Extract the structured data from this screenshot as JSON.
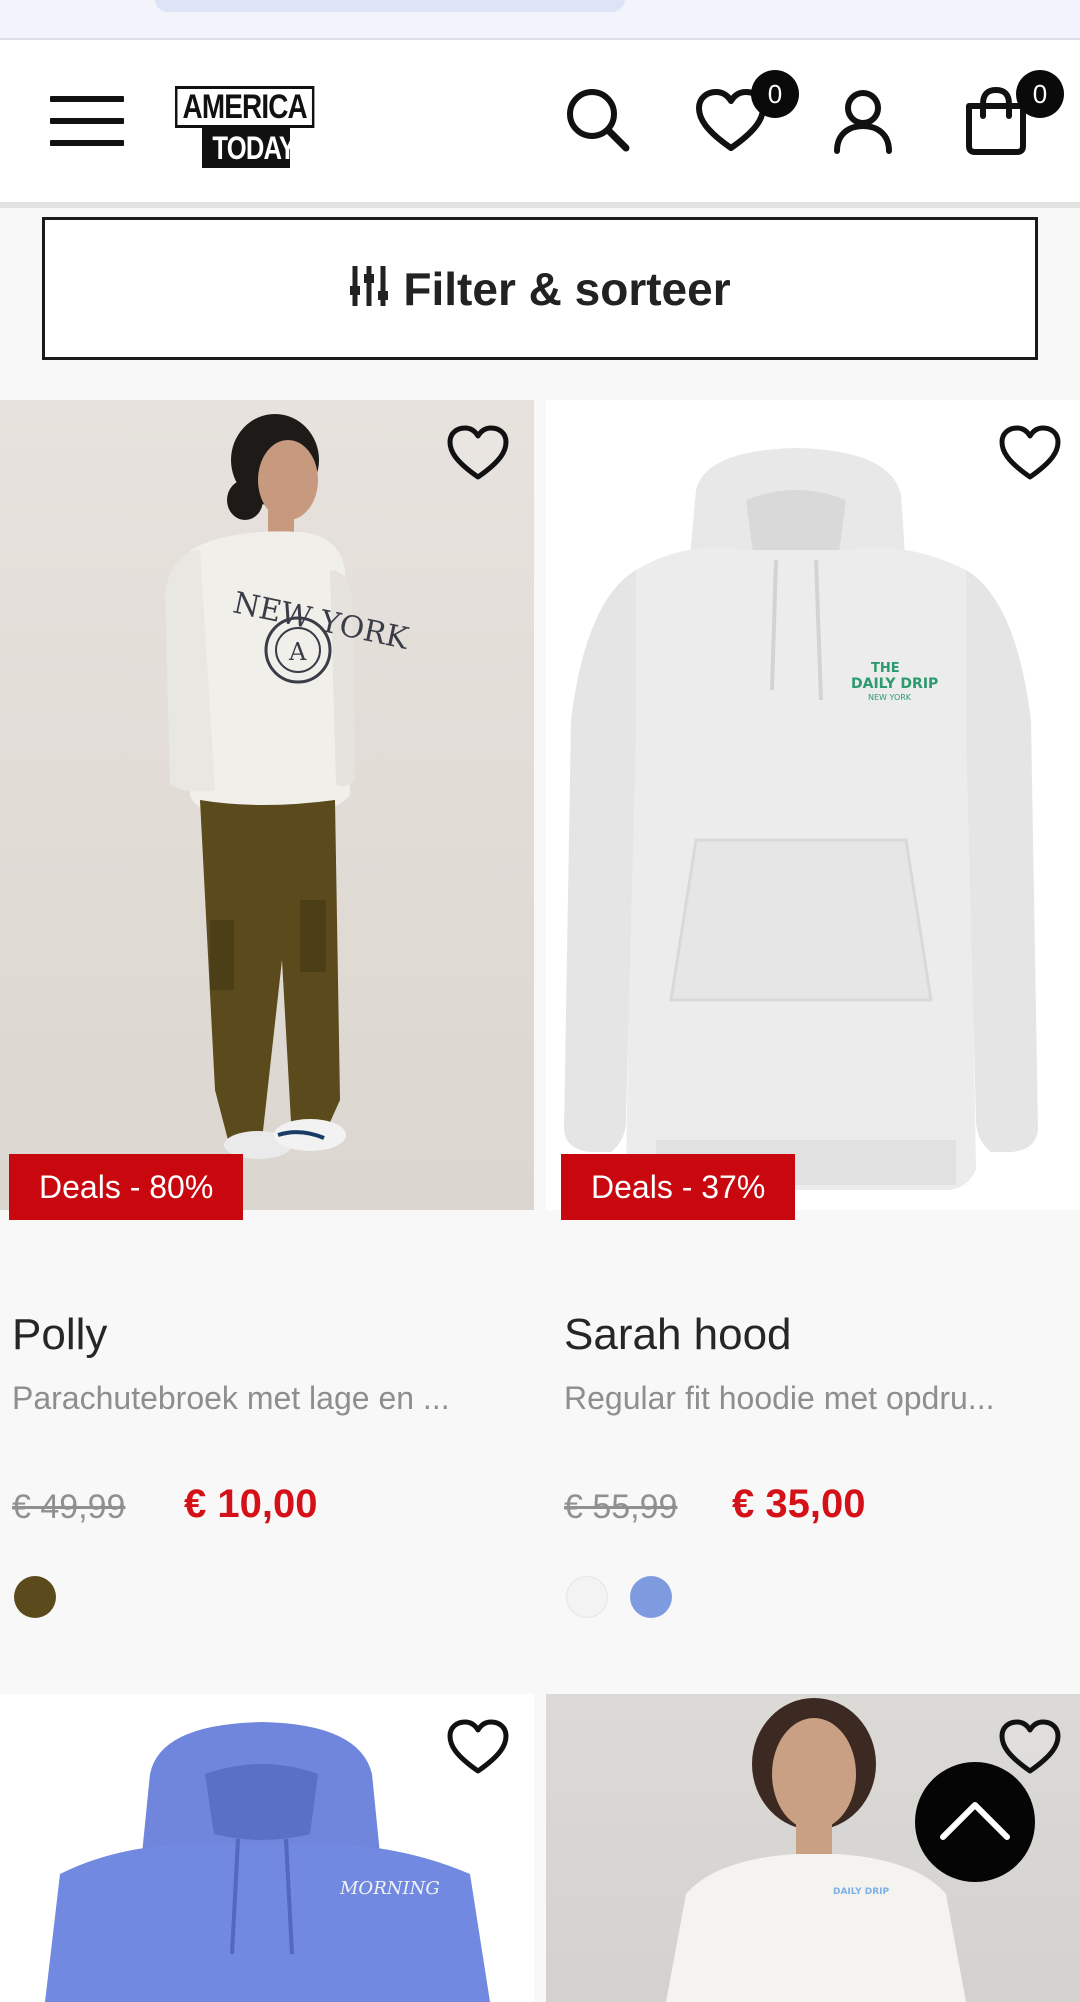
{
  "header": {
    "logo_line1": "AMERICA",
    "logo_line2": "TODAY",
    "wishlist_count": "0",
    "cart_count": "0"
  },
  "filter": {
    "label": "Filter & sorteer"
  },
  "products": [
    {
      "name": "Polly",
      "description": "Parachutebroek met lage en ...",
      "deal": "Deals - 80%",
      "old_price": "€ 49,99",
      "new_price": "€ 10,00",
      "swatches": [
        "#5a4a1c"
      ]
    },
    {
      "name": "Sarah hood",
      "description": "Regular fit hoodie met opdru...",
      "deal": "Deals - 37%",
      "old_price": "€ 55,99",
      "new_price": "€ 35,00",
      "swatches": [
        "#f3f3f3",
        "#7f9be0"
      ]
    },
    {
      "name": "",
      "description": ""
    },
    {
      "name": "",
      "description": ""
    }
  ],
  "colors": {
    "deal_red": "#c8070f",
    "price_red": "#d41118",
    "product1_image": "illustration: woman in white NEW YORK sweatshirt and olive cargo pants",
    "product2_image_print": "THE DAILY DRIP"
  }
}
